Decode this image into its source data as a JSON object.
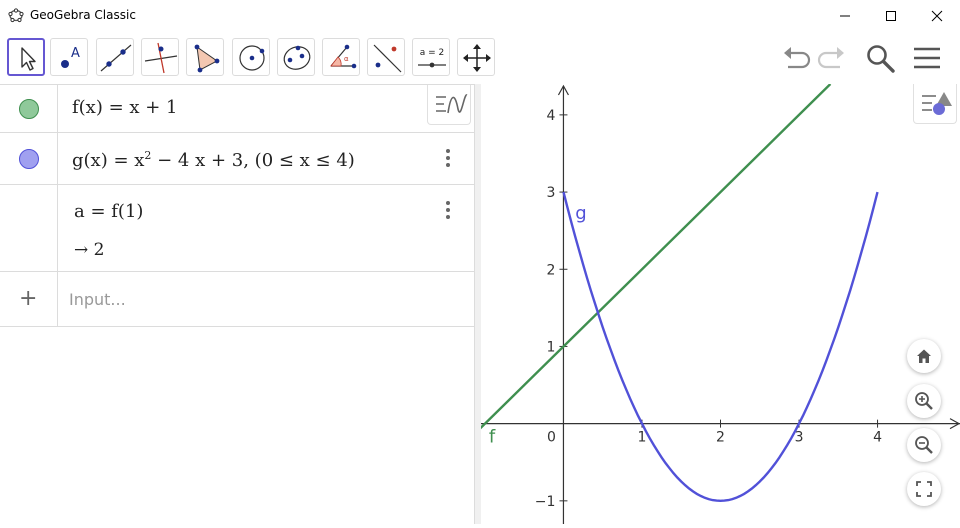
{
  "window": {
    "title": "GeoGebra Classic"
  },
  "toolbar": {
    "tools": [
      "move-tool",
      "point-tool",
      "line-tool",
      "perpendicular-line-tool",
      "polygon-tool",
      "circle-center-tool",
      "conic-tool",
      "angle-tool",
      "reflect-tool",
      "slider-tool",
      "move-graphics-tool"
    ],
    "slider_label": "a = 2"
  },
  "algebra": {
    "rows": [
      {
        "expr": "f(x) = x + 1",
        "color": "#8fc99a"
      },
      {
        "expr_main": "g(x) = x",
        "exponent": "2",
        "expr_rest": " − 4 x + 3,    (0 ≤ x ≤ 4)",
        "color": "#a0a0f0"
      },
      {
        "expr": "a = f(1)",
        "result": "→ 2"
      }
    ],
    "input_icon": "+",
    "input_placeholder": "Input..."
  },
  "graphics": {
    "x_ticks": [
      "0",
      "1",
      "2",
      "3",
      "4"
    ],
    "y_ticks": [
      "4",
      "3",
      "2",
      "1",
      "−1"
    ],
    "label_f": "f",
    "label_g": "g",
    "colors": {
      "f": "#3f8f4f",
      "g": "#5151d8",
      "axis": "#333333"
    }
  },
  "chart_data": {
    "type": "line",
    "xlim": [
      -1.05,
      5.05
    ],
    "ylim": [
      -1.3,
      4.4
    ],
    "series": [
      {
        "name": "f",
        "x": [
          -1.1,
          3.4
        ],
        "y": [
          -0.1,
          4.4
        ]
      },
      {
        "name": "g",
        "x": [
          0,
          0.25,
          0.5,
          0.75,
          1,
          1.25,
          1.5,
          1.75,
          2,
          2.25,
          2.5,
          2.75,
          3,
          3.25,
          3.5,
          3.75,
          4
        ],
        "y": [
          3,
          2.0625,
          1.25,
          0.5625,
          0,
          -0.4375,
          -0.75,
          -0.9375,
          -1,
          -0.9375,
          -0.75,
          -0.4375,
          0,
          0.5625,
          1.25,
          2.0625,
          3
        ]
      }
    ]
  }
}
